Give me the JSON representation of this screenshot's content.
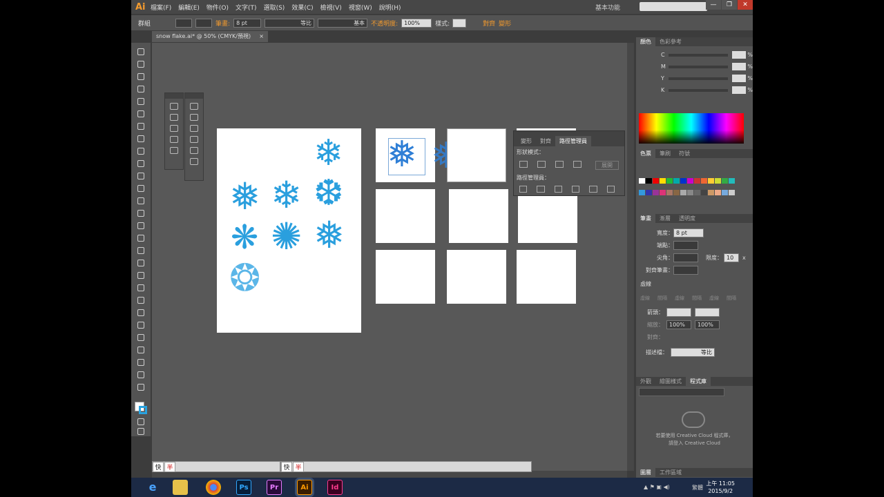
{
  "app": {
    "logo": "Ai",
    "workspace": "基本功能"
  },
  "menu": [
    "檔案(F)",
    "編輯(E)",
    "物件(O)",
    "文字(T)",
    "選取(S)",
    "效果(C)",
    "檢視(V)",
    "視窗(W)",
    "說明(H)"
  ],
  "window_controls": [
    "—",
    "❐",
    "✕"
  ],
  "control_bar": {
    "group_label": "群組",
    "stroke_label": "筆畫:",
    "stroke_value": "8 pt",
    "profile_uniform": "等比",
    "brush_basic": "基本",
    "opacity_label": "不透明度:",
    "opacity_value": "100%",
    "style_label": "樣式:",
    "align_label": "對齊",
    "transform_label": "變形"
  },
  "document": {
    "tab_title": "snow flake.ai* @ 50% (CMYK/預視)",
    "close": "×"
  },
  "pathfinder": {
    "tabs": [
      "變形",
      "對齊",
      "路徑管理員"
    ],
    "shape_modes_label": "形狀模式：",
    "expand_label": "展開",
    "pathfinders_label": "路徑管理員："
  },
  "color_panel": {
    "tabs": [
      "顏色",
      "色彩參考"
    ],
    "channels": [
      "C",
      "M",
      "Y",
      "K"
    ],
    "percent": "%"
  },
  "swatches_panel": {
    "tabs": [
      "色票",
      "筆刷",
      "符號"
    ]
  },
  "stroke_panel": {
    "tabs": [
      "筆畫",
      "漸層",
      "透明度"
    ],
    "weight_label": "寬度：",
    "weight_value": "8 pt",
    "cap_label": "端點：",
    "corner_label": "尖角：",
    "limit_label": "限度：",
    "limit_value": "10",
    "limit_unit": "x",
    "align_label": "對齊筆畫：",
    "dashed_label": "虛線",
    "dash_labels": [
      "虛線",
      "間隔",
      "虛線",
      "間隔",
      "虛線",
      "間隔"
    ],
    "arrow_label": "箭頭：",
    "scale_label": "縮放：",
    "scale_value": "100%",
    "align_arrow_label": "對齊：",
    "profile_label": "描述檔：",
    "profile_value": "等比"
  },
  "library_panel": {
    "tabs": [
      "外觀",
      "繪圖樣式",
      "程式庫"
    ],
    "cc_line1": "若要使用 Creative Cloud 程式庫，",
    "cc_line2": "請登入 Creative Cloud"
  },
  "bottom_panel": {
    "tabs": [
      "圖層",
      "工作區域"
    ]
  },
  "ime": {
    "key1": "快",
    "key2": "半"
  },
  "status_bar": {
    "zoom": "50%"
  },
  "taskbar": {
    "apps": [
      "ie",
      "folder",
      "chrome",
      "Ps",
      "Pr",
      "Ai",
      "Id"
    ],
    "tray_lang": "繁體",
    "time": "上午 11:05",
    "date": "2015/9/2"
  },
  "colors": {
    "snowflake": "#2a9fde",
    "accent_orange": "#f29a2e",
    "panel": "#535353",
    "canvas": "#585858"
  }
}
